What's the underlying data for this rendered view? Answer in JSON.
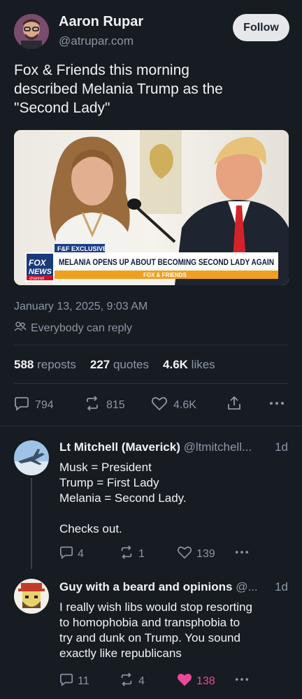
{
  "post": {
    "author_name": "Aaron Rupar",
    "author_handle": "@atrupar.com",
    "follow_label": "Follow",
    "text": "Fox & Friends this morning\ndescribed Melania Trump as the\n\"Second Lady\"",
    "image": {
      "chyron_tag": "F&F EXCLUSIVE",
      "chyron_headline": "MELANIA OPENS UP ABOUT BECOMING SECOND LADY AGAIN",
      "chyron_show": "FOX & FRIENDS",
      "logo_line1": "FOX",
      "logo_line2": "NEWS",
      "logo_line3": "channel"
    },
    "timestamp": "January 13, 2025, 9:03 AM",
    "reply_setting": "Everybody can reply",
    "reposts_count": "588",
    "reposts_label": "reposts",
    "quotes_count": "227",
    "quotes_label": "quotes",
    "likes_count": "4.6K",
    "likes_label": "likes",
    "reply_count": "794",
    "repost_count": "815",
    "like_count": "4.6K"
  },
  "replies": [
    {
      "name": "Lt Mitchell (Maverick)",
      "handle": "@ltmitchell...",
      "age": "1d",
      "text": "Musk = President\nTrump = First Lady\nMelania = Second Lady.\n\nChecks out.",
      "replies": "4",
      "reposts": "1",
      "likes": "139"
    },
    {
      "name": "Guy with a beard and opinions",
      "handle": "@...",
      "age": "1d",
      "text": "I really wish libs would stop resorting\nto homophobia and transphobia to\ntry and dunk on Trump. You sound\nexactly like republicans",
      "replies": "11",
      "reposts": "4",
      "likes": "138"
    }
  ],
  "colors": {
    "background": "#171b22",
    "muted": "#8b98a5",
    "like_active": "#ec4899"
  }
}
